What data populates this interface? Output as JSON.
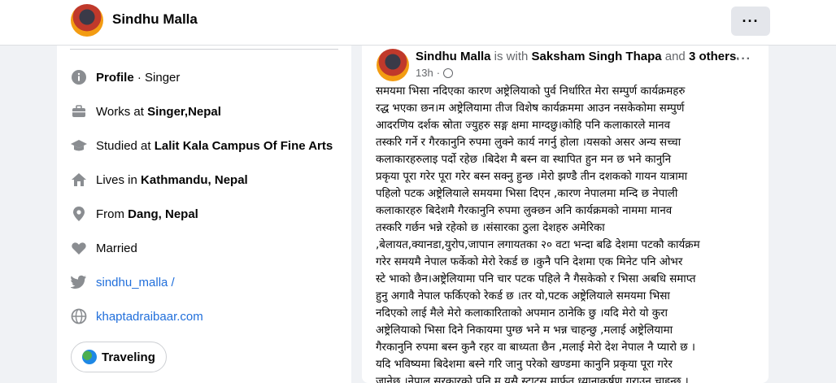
{
  "profile": {
    "name": "Sindhu Malla",
    "more_label": "···"
  },
  "intro": {
    "rows": [
      {
        "icon": "info-icon",
        "pre": "",
        "bold": "Profile",
        "post": " · Singer"
      },
      {
        "icon": "briefcase-icon",
        "pre": "Works at ",
        "bold": "Singer,Nepal",
        "post": ""
      },
      {
        "icon": "graduation-cap-icon",
        "pre": "Studied at ",
        "bold": "Lalit Kala Campus Of Fine Arts",
        "post": ""
      },
      {
        "icon": "home-icon",
        "pre": "Lives in ",
        "bold": "Kathmandu, Nepal",
        "post": ""
      },
      {
        "icon": "location-pin-icon",
        "pre": "From ",
        "bold": "Dang, Nepal",
        "post": ""
      },
      {
        "icon": "heart-icon",
        "pre": "Married",
        "bold": "",
        "post": ""
      }
    ],
    "twitter": "sindhu_malla /",
    "website": "khaptadraibaar.com",
    "hobby": "Traveling"
  },
  "post": {
    "author": "Sindhu Malla",
    "with_text": " is with ",
    "tagged": "Saksham Singh Thapa",
    "and_text": " and ",
    "others": "3 others",
    "period": ".",
    "time": "13h",
    "dot": "·",
    "more_label": "···",
    "lines": [
      "समयमा भिसा नदिएका कारण अष्ट्रेलियाको पुर्व निर्धारित मेरा सम्पुर्ण कार्यक्रमहरु",
      "रद्ध भएका छन।म अष्ट्रेलियामा तीज विशेष कार्यक्रममा आउन नसकेकोमा सम्पुर्ण",
      "आदरणिय दर्शक स्रोता ज्युहरु सङ्ग क्षमा माग्दछु।कोहि पनि कलाकारले मानव",
      "तस्करि गर्ने र गैरकानुनि रुपमा लुक्ने  कार्य नगर्नु होला ।यसको असर अन्य सच्चा",
      "कलाकारहरुलाइ पर्दो रहेछ ।बिदेश मै बस्न वा स्थापित हुन मन छ भने कानुनि",
      "प्रकृया पूरा गरेर पूरा गरेर बस्न सक्नु हुन्छ ।मेरो झण्डै तीन दशकको गायन यात्रामा",
      "पहिलो पटक अष्ट्रेलियाले समयमा भिसा दिएन ,कारण नेपालमा मन्दि छ नेपाली",
      "कलाकारहरु बिदेशमै गैरकानुनि रुपमा लुक्छन अनि कार्यक्रमको नाममा मानव",
      "तस्करि गर्छन भन्ने रहेको छ ।संसारका ठुला देशहरु अमेरिका",
      ",बेलायत,क्यानडा,युरोप,जापान लगायतका २० वटा भन्दा बढि देशमा पटकौ कार्यक्रम",
      "गरेर समयमै नेपाल फर्केको मेरो रेकर्ड छ ।कुनै पनि देशमा एक मिनेट पनि ओभर",
      "स्टे भाको छैन।अष्ट्रेलियामा पनि चार पटक पहिले नै गैसकेको र भिसा अबधि समाप्त",
      "हुनु अगावै नेपाल फर्किएको रेकर्ड छ ।तर यो,पटक अष्ट्रेलियाले समयमा भिसा",
      "नदिएको लाई मैले मेरो कलाकारिताको अपमान ठानेकि छु ।यदि मेरो यो कुरा",
      "अष्ट्रेलियाको भिसा दिने निकायमा पुग्छ भने म भन्न चाहन्छु ,मलाई अष्ट्रेलियामा",
      "गैरकानुनि रुपमा बस्न कुनै रहर वा बाध्यता छैन ,मलाई मेरो देश नेपाल नै प्यारो छ ।",
      "यदि भविष्यमा बिदेशमा बस्ने गरि जानु परेको खण्डमा कानुनि प्रकृया पूरा गरेर",
      "जानेछु ।नेपाल सरकारको पनि म यसै स्टाटस मार्फत ध्यानाकर्षण गराउन चाहन्छु ।"
    ]
  },
  "colors": {
    "link": "#216fdb",
    "muted": "#65676b",
    "page_bg": "#f0f2f5"
  }
}
